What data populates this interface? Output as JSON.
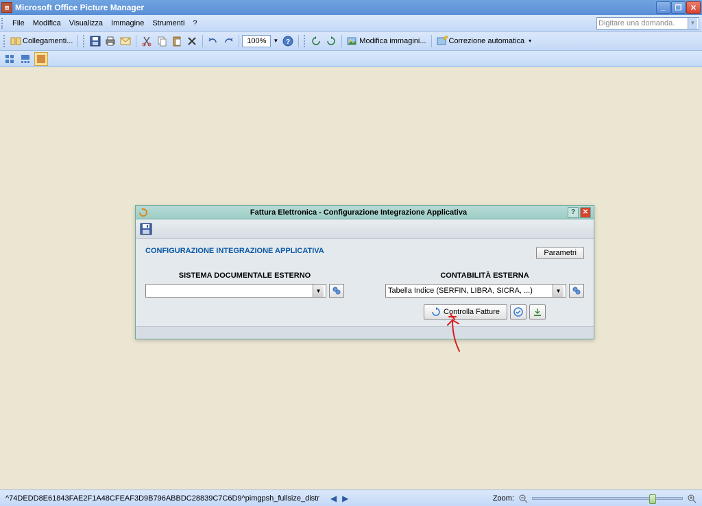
{
  "titlebar": {
    "title": "Microsoft Office Picture Manager"
  },
  "menubar": {
    "items": [
      "File",
      "Modifica",
      "Visualizza",
      "Immagine",
      "Strumenti",
      "?"
    ],
    "search_placeholder": "Digitare una domanda."
  },
  "toolbar": {
    "shortcuts_label": "Collegamenti...",
    "zoom_value": "100%",
    "edit_images_label": "Modifica immagini...",
    "autocorrect_label": "Correzione automatica"
  },
  "dialog": {
    "title": "Fattura Elettronica - Configurazione Integrazione Applicativa",
    "heading": "CONFIGURAZIONE INTEGRAZIONE APPLICATIVA",
    "param_button": "Parametri",
    "col_left_label": "SISTEMA DOCUMENTALE ESTERNO",
    "col_right_label": "CONTABILITÀ ESTERNA",
    "combo_right_value": "Tabella Indice (SERFIN, LIBRA, SICRA, ...)",
    "controlla_label": "Controlla Fatture"
  },
  "statusbar": {
    "filename": "^74DEDD8E61843FAE2F1A48CFEAF3D9B796ABBDC28839C7C6D9^pimgpsh_fullsize_distr",
    "zoom_label": "Zoom:"
  }
}
